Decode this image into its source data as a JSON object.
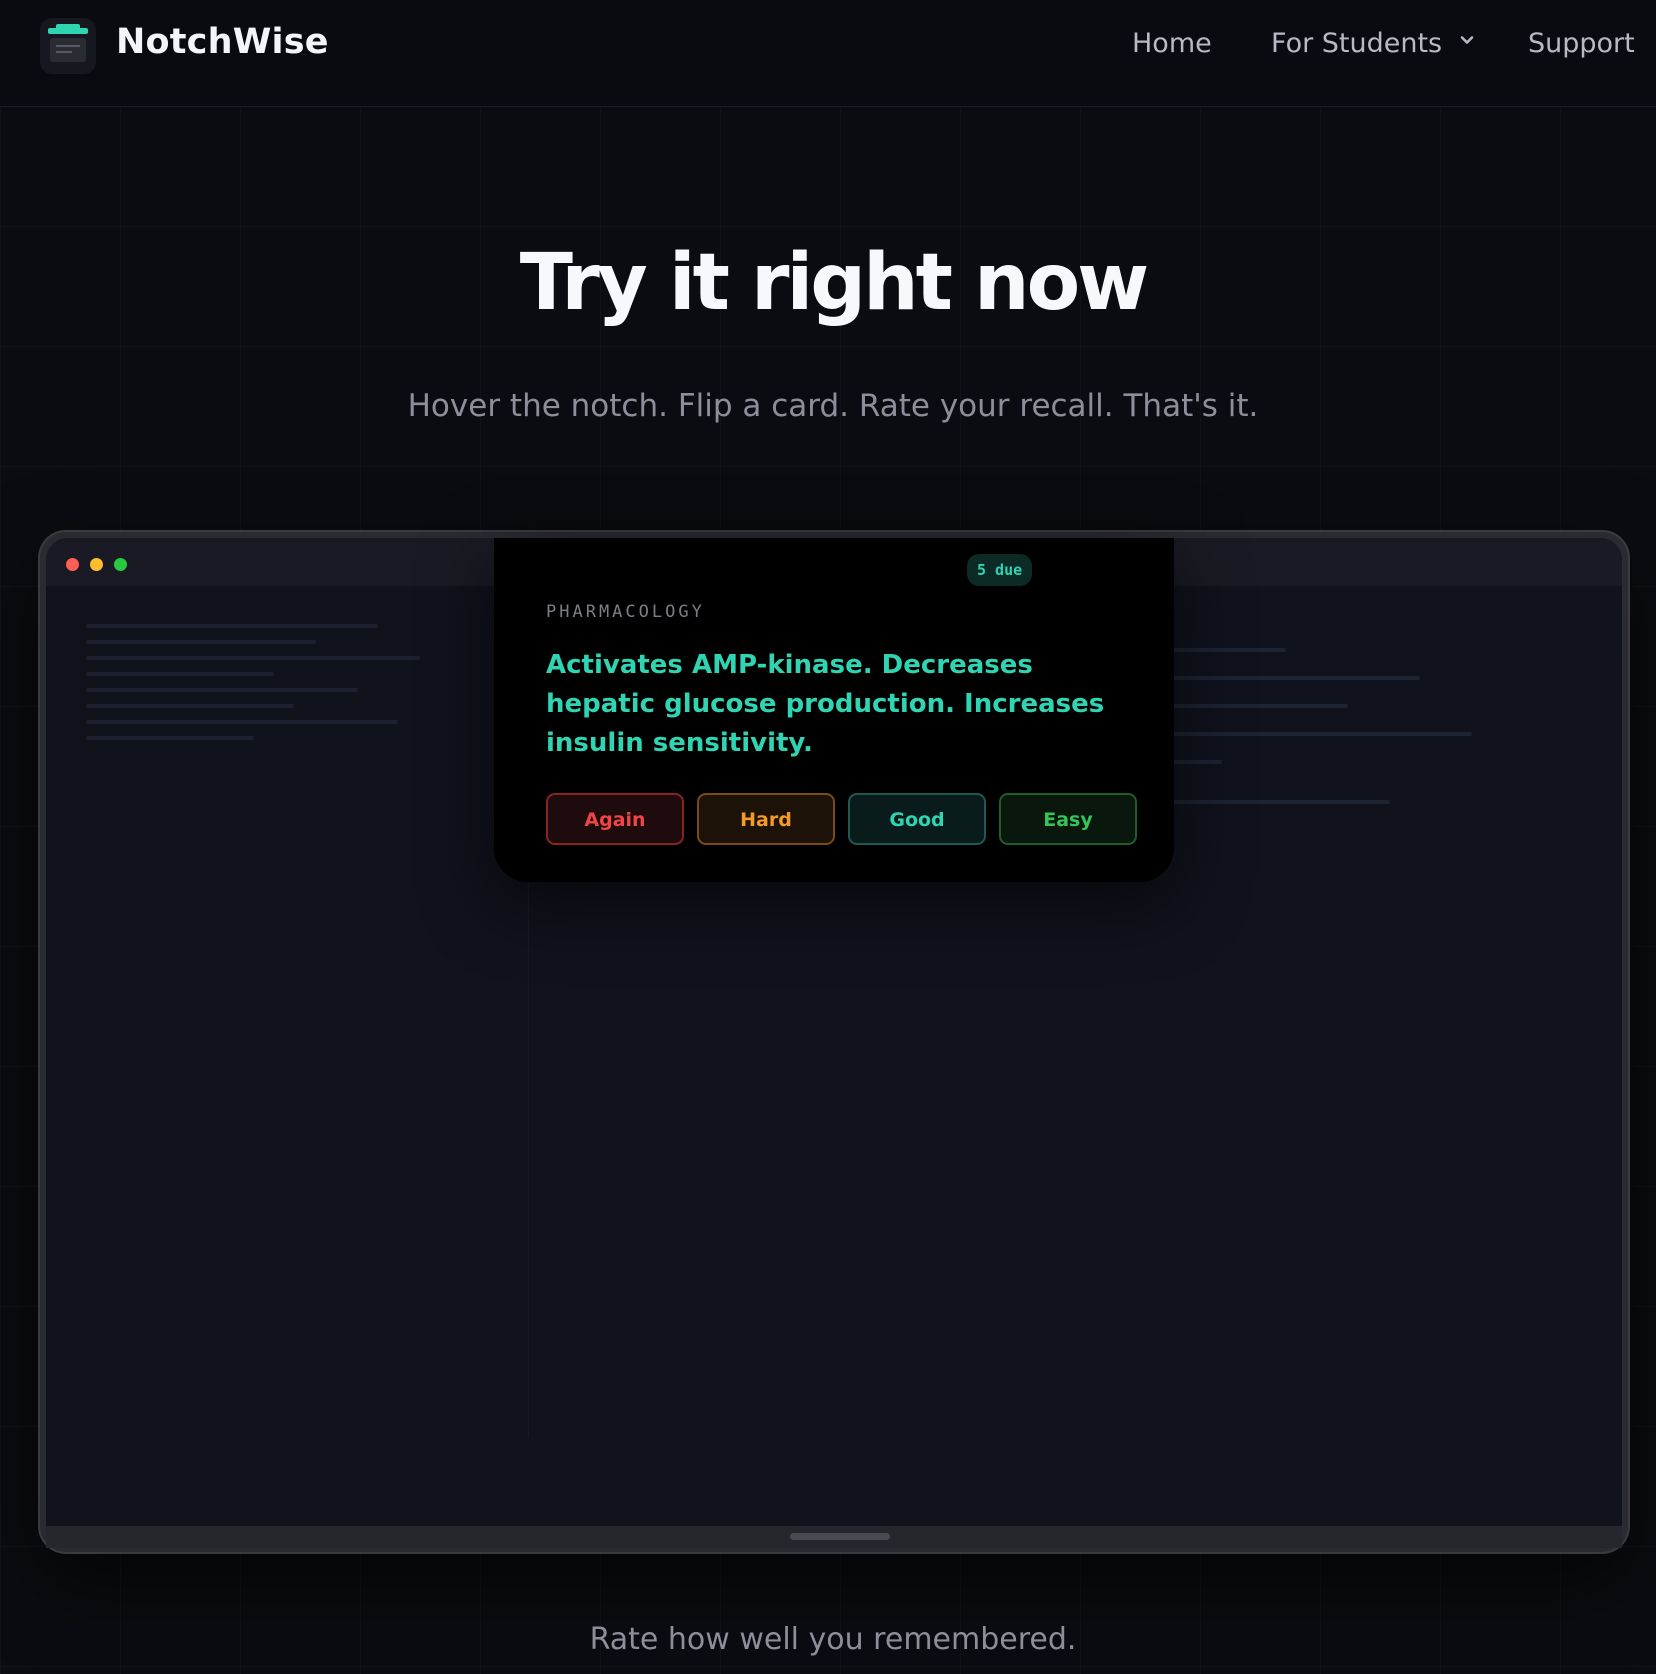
{
  "nav": {
    "brand": "NotchWise",
    "links": {
      "home": "Home",
      "students": "For Students",
      "support": "Support"
    },
    "accent_color": "#2fd4b2"
  },
  "hero": {
    "title": "Try it right now",
    "subtitle": "Hover the notch. Flip a card. Rate your recall. That's it."
  },
  "card": {
    "due_badge": "5 due",
    "category": "PHARMACOLOGY",
    "text": "Activates AMP-kinase. Decreases hepatic glucose production. Increases insulin sensitivity.",
    "buttons": {
      "again": "Again",
      "hard": "Hard",
      "good": "Good",
      "easy": "Easy"
    },
    "button_colors": {
      "again": "#f04545",
      "hard": "#f39a2b",
      "good": "#2fd4b2",
      "easy": "#35c45a"
    }
  },
  "window_controls": {
    "close_color": "#ff5f57",
    "minimize_color": "#febc2e",
    "maximize_color": "#28c840"
  },
  "footer": {
    "caption": "Rate how well you remembered."
  }
}
